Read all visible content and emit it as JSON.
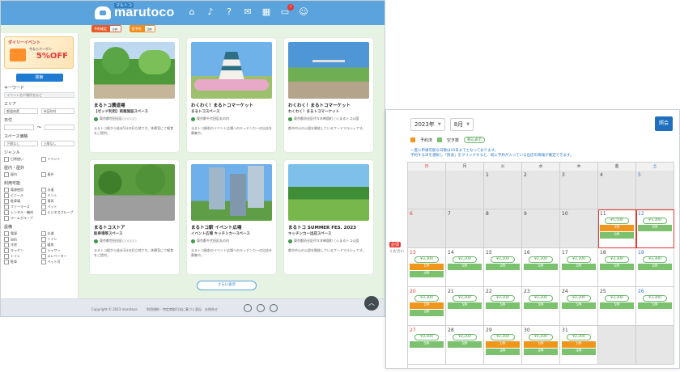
{
  "listing": {
    "brand": "marutoco",
    "brand_badge": "マルトコ",
    "chips": [
      {
        "a": "予約確定",
        "b": "0件"
      },
      {
        "a": "仮予約",
        "b": "0件"
      }
    ],
    "sidebar": {
      "banner_tag": "ダイリーイベント",
      "banner_sub": "今ならクーポン",
      "banner_off": "5%OFF",
      "search_button": "検索",
      "keyword_label": "キーワード",
      "keyword_placeholder": "イベント名や場所名など",
      "area_label": "エリア",
      "area_value": "都道府県",
      "area_value2": "市区町村",
      "date_label": "日付",
      "date_sep": "〜",
      "price_label": "スペース価格",
      "price_min": "下限なし",
      "price_max": "上限なし",
      "type_label": "ジャンル",
      "type_opts": [
        "日常使い",
        "イベント"
      ],
      "place_label": "屋内・屋外",
      "place_opts": [
        "屋内",
        "屋外"
      ],
      "facility_label": "利用可能",
      "facility_opts": [
        "電源使用",
        "水道",
        "ビニール",
        "テント",
        "駐車場",
        "車両",
        "ファーマーズ",
        "ペット",
        "レンタル・機材",
        "ビジネスグループ",
        "ホームグループ",
        ""
      ],
      "other_label": "設備",
      "other_opts": [
        "電源",
        "水道",
        "WiFi",
        "トイレ",
        "冷房",
        "暖房",
        "キッチン",
        "シャワー",
        "トイレ",
        "エレベーター",
        "駐車",
        "ペット可"
      ]
    },
    "cards": [
      {
        "title": "まるトコ農道場",
        "sub": "【ゼッド利用】商業施設スペース",
        "loc": "東京都世田谷区○○○○○",
        "desc": "まるトコ駅から徒歩5分の好立地です。休憩室にて軽食をご提供。"
      },
      {
        "title": "わくわく！まるトコマーケット",
        "sub": "まるトコスペース",
        "loc": "東京都千代田区丸の内",
        "desc": "まるトコ駅前のイベント広場へのキッチンカーの出店を募集中。"
      },
      {
        "title": "わくわく！まるトコマーケット",
        "sub": "わくわく！まるトコマーケット",
        "loc": "東京都渋谷区代々木神園町 ○○まるトコ公園",
        "desc": "都市中心の公園を開放しているフードマルシェです。"
      },
      {
        "title": "まるトコストア",
        "sub": "駐車場等スペース",
        "loc": "東京都世田谷区○○○○○",
        "desc": "まるトコ駅から徒歩3分の好立地です。休憩室にて軽食をご提供。"
      },
      {
        "title": "まるトコ駅 イベント広場",
        "sub": "イベント広場 キッチンカースペース",
        "loc": "東京都千代田区丸の内",
        "desc": "まるトコ駅前のイベント広場へのキッチンカーの出店を募集中。"
      },
      {
        "title": "まるトコ SUMMER FES. 2023",
        "sub": "キッチンカー出店スペース",
        "loc": "東京都渋谷区代々木神園町 ○○まるトコ公園",
        "desc": "都市中心の公園を開放しているフードマルシェです。"
      }
    ],
    "more_button": "さらに表示",
    "footer_copy": "Copyright © 2023 marutoco",
    "footer_links": "利用規約・特定商取引法に基づく表記　お問合せ"
  },
  "calendar": {
    "year": "2023年",
    "month": "8月",
    "apply_button": "照会",
    "legend": [
      {
        "label": "予約済",
        "color": "#f0961c"
      },
      {
        "label": "空き数",
        "color": "#7cc26e"
      }
    ],
    "legend_note": "税込表示",
    "notice": [
      "一度に申請可能な日数は10日までとなっております。",
      "予約する日を選択し「照会」をクリックすると、既に予約が入っている出店の情報が確定できます。"
    ],
    "side_tag": "必須",
    "side_tag2": "ください",
    "weekdays": [
      "日",
      "月",
      "火",
      "水",
      "木",
      "金",
      "土"
    ],
    "weeks": [
      [
        {
          "d": "",
          "gray": true
        },
        {
          "d": "",
          "gray": true
        },
        {
          "d": "1",
          "gray": true
        },
        {
          "d": "2",
          "gray": true
        },
        {
          "d": "3",
          "gray": true
        },
        {
          "d": "4",
          "gray": true
        },
        {
          "d": "5",
          "gray": true
        }
      ],
      [
        {
          "d": "6",
          "gray": true
        },
        {
          "d": "7",
          "gray": true
        },
        {
          "d": "8",
          "gray": true
        },
        {
          "d": "9",
          "gray": true
        },
        {
          "d": "10",
          "gray": true
        },
        {
          "d": "11",
          "price": "¥5,500",
          "o": "3件",
          "g": "2件",
          "sel": true
        },
        {
          "d": "12",
          "price": "¥3,300",
          "g": "5件",
          "sel": true
        }
      ],
      [
        {
          "d": "13",
          "price": "¥3,300",
          "o": "1件",
          "g": "4件"
        },
        {
          "d": "14",
          "price": "¥2,200",
          "g": "5件"
        },
        {
          "d": "15",
          "price": "¥2,200",
          "g": "5件"
        },
        {
          "d": "16",
          "price": "¥2,200",
          "g": "5件"
        },
        {
          "d": "17",
          "price": "¥2,200",
          "g": "5件"
        },
        {
          "d": "18",
          "price": "¥3,300",
          "g": "5件"
        },
        {
          "d": "19",
          "price": "¥3,300",
          "g": "5件"
        }
      ],
      [
        {
          "d": "20",
          "price": "¥3,300",
          "o": "1件",
          "g": "4件"
        },
        {
          "d": "21",
          "price": "¥2,200",
          "g": "5件"
        },
        {
          "d": "22",
          "price": "¥2,200",
          "g": "5件"
        },
        {
          "d": "23",
          "price": "¥2,200",
          "g": "5件"
        },
        {
          "d": "24",
          "price": "¥2,200",
          "g": "5件"
        },
        {
          "d": "25",
          "price": "¥3,300",
          "g": "5件"
        },
        {
          "d": "26",
          "price": "¥3,300",
          "g": "5件"
        }
      ],
      [
        {
          "d": "27",
          "price": "¥3,300",
          "g": "5件"
        },
        {
          "d": "28",
          "price": "¥2,200",
          "g": "5件"
        },
        {
          "d": "29",
          "price": "¥2,200",
          "o": "1件",
          "g": "4件"
        },
        {
          "d": "30",
          "price": "¥2,200",
          "o": "1件",
          "g": "4件"
        },
        {
          "d": "31",
          "price": "¥2,200",
          "o": "1件",
          "g": "4件"
        },
        {
          "d": "",
          "gray": true
        },
        {
          "d": "",
          "gray": true
        }
      ]
    ]
  }
}
